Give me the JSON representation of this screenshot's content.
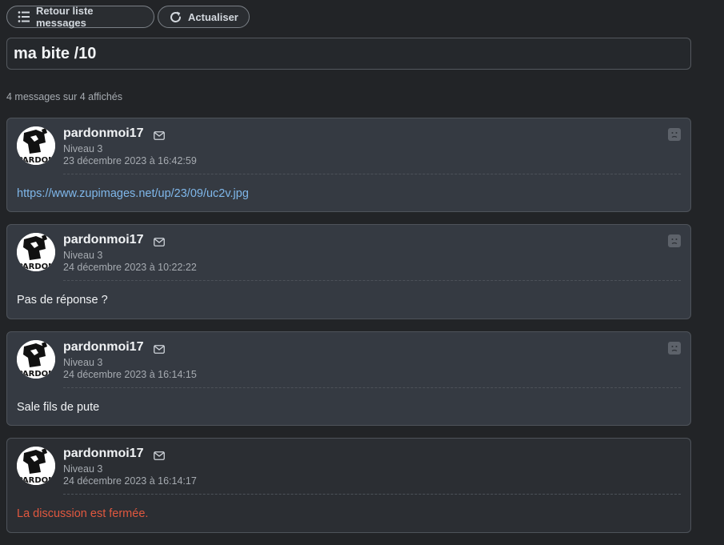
{
  "toolbar": {
    "back_label": "Retour liste messages",
    "back_icon": "list-icon",
    "refresh_label": "Actualiser",
    "refresh_icon": "refresh-icon"
  },
  "topic": {
    "title": "ma bite /10"
  },
  "summary": {
    "count_text": "4 messages sur 4 affichés"
  },
  "avatar_text": "PARDON",
  "messages": [
    {
      "author": "pardonmoi17",
      "level": "Niveau 3",
      "date": "23 décembre 2023 à 16:42:59",
      "body": "https://www.zupimages.net/up/23/09/uc2v.jpg",
      "body_type": "link",
      "has_report": true
    },
    {
      "author": "pardonmoi17",
      "level": "Niveau 3",
      "date": "24 décembre 2023 à 10:22:22",
      "body": "Pas de réponse ?",
      "body_type": "text",
      "has_report": true
    },
    {
      "author": "pardonmoi17",
      "level": "Niveau 3",
      "date": "24 décembre 2023 à 16:14:15",
      "body": "Sale fils de pute",
      "body_type": "text",
      "has_report": true
    },
    {
      "author": "pardonmoi17",
      "level": "Niveau 3",
      "date": "24 décembre 2023 à 16:14:17",
      "body": "La discussion est fermée.",
      "body_type": "system-closed",
      "has_report": false
    }
  ],
  "colors": {
    "background": "#222427",
    "card": "#353a42",
    "link": "#7fb7ea",
    "closed_notice": "#e1583f"
  }
}
